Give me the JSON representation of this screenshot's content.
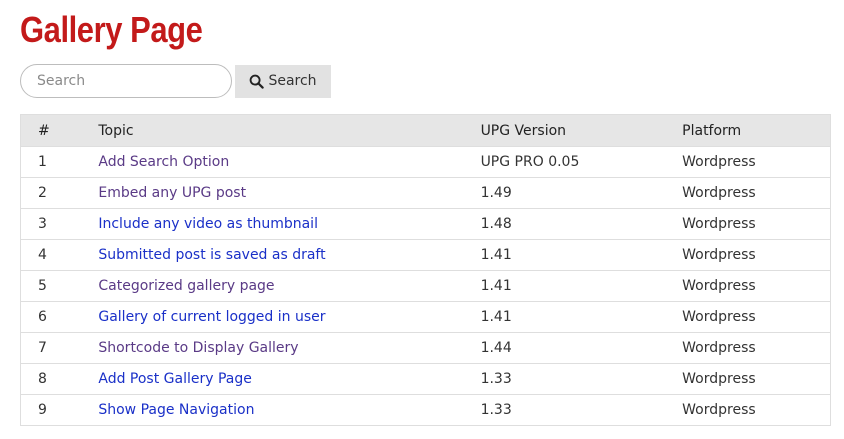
{
  "page": {
    "title": "Gallery Page"
  },
  "search": {
    "placeholder": "Search",
    "value": "",
    "button_label": "Search",
    "button_icon": "search-icon"
  },
  "table": {
    "headers": [
      "#",
      "Topic",
      "UPG Version",
      "Platform"
    ],
    "rows": [
      {
        "num": "1",
        "topic": "Add Search Option",
        "version": "UPG PRO 0.05",
        "platform": "Wordpress",
        "visited": true
      },
      {
        "num": "2",
        "topic": "Embed any UPG post",
        "version": "1.49",
        "platform": "Wordpress",
        "visited": true
      },
      {
        "num": "3",
        "topic": "Include any video as thumbnail",
        "version": "1.48",
        "platform": "Wordpress",
        "visited": false
      },
      {
        "num": "4",
        "topic": "Submitted post is saved as draft",
        "version": "1.41",
        "platform": "Wordpress",
        "visited": false
      },
      {
        "num": "5",
        "topic": "Categorized gallery page",
        "version": "1.41",
        "platform": "Wordpress",
        "visited": true
      },
      {
        "num": "6",
        "topic": "Gallery of current logged in user",
        "version": "1.41",
        "platform": "Wordpress",
        "visited": false
      },
      {
        "num": "7",
        "topic": "Shortcode to Display Gallery",
        "version": "1.44",
        "platform": "Wordpress",
        "visited": true
      },
      {
        "num": "8",
        "topic": "Add Post Gallery Page",
        "version": "1.33",
        "platform": "Wordpress",
        "visited": false
      },
      {
        "num": "9",
        "topic": "Show Page Navigation",
        "version": "1.33",
        "platform": "Wordpress",
        "visited": false
      }
    ]
  },
  "colors": {
    "title": "#c31a1a",
    "link": "#1a30c8",
    "link_visited": "#5a3a86",
    "header_bg": "#e6e6e6",
    "button_bg": "#e2e2e2"
  }
}
